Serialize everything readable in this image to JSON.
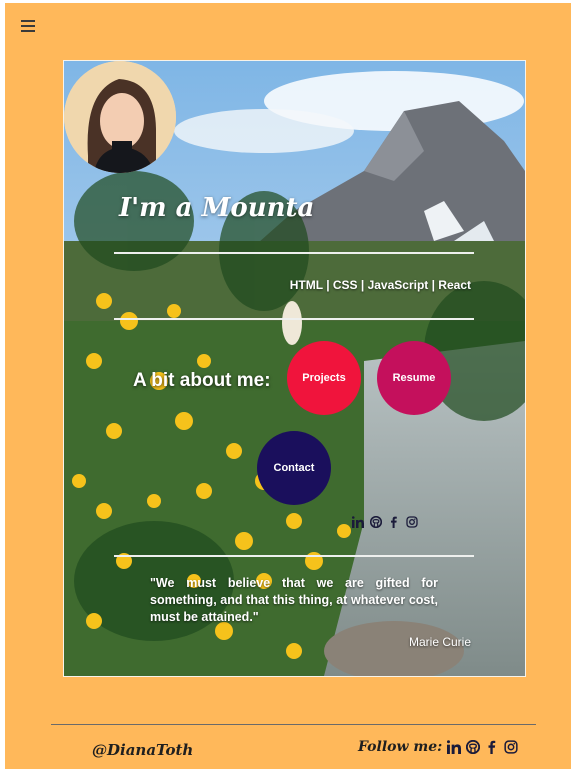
{
  "nav": {
    "menu_icon": "hamburger-menu-icon"
  },
  "hero": {
    "headline": "I'm a Mounta",
    "skills": "HTML | CSS | JavaScript | React",
    "about_label": "A bit about me:"
  },
  "buttons": {
    "projects": "Projects",
    "resume": "Resume",
    "contact": "Contact"
  },
  "social_icons": [
    "linkedin-icon",
    "github-icon",
    "facebook-icon",
    "instagram-icon"
  ],
  "quote": {
    "text": "\"We must believe that we are gifted for something, and that this thing, at whatever cost, must be attained.\"",
    "author": "Marie Curie"
  },
  "footer": {
    "handle": "@DianaToth",
    "follow_label": "Follow me:"
  },
  "colors": {
    "page_background": "#ffb85a",
    "projects_button": "#f0143c",
    "resume_button": "#c4105c",
    "contact_button": "#1a0f5c",
    "icon_dark": "#1b1b3a"
  }
}
